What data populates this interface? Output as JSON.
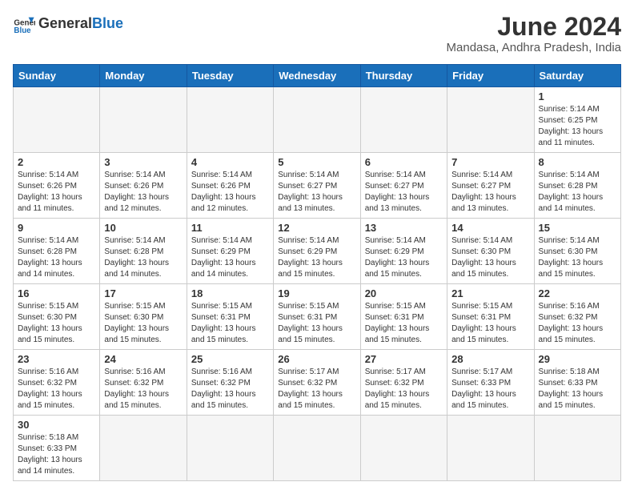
{
  "header": {
    "logo_general": "General",
    "logo_blue": "Blue",
    "month_year": "June 2024",
    "location": "Mandasa, Andhra Pradesh, India"
  },
  "weekdays": [
    "Sunday",
    "Monday",
    "Tuesday",
    "Wednesday",
    "Thursday",
    "Friday",
    "Saturday"
  ],
  "weeks": [
    [
      {
        "day": "",
        "info": ""
      },
      {
        "day": "",
        "info": ""
      },
      {
        "day": "",
        "info": ""
      },
      {
        "day": "",
        "info": ""
      },
      {
        "day": "",
        "info": ""
      },
      {
        "day": "",
        "info": ""
      },
      {
        "day": "1",
        "info": "Sunrise: 5:14 AM\nSunset: 6:25 PM\nDaylight: 13 hours and 11 minutes."
      }
    ],
    [
      {
        "day": "2",
        "info": "Sunrise: 5:14 AM\nSunset: 6:26 PM\nDaylight: 13 hours and 11 minutes."
      },
      {
        "day": "3",
        "info": "Sunrise: 5:14 AM\nSunset: 6:26 PM\nDaylight: 13 hours and 12 minutes."
      },
      {
        "day": "4",
        "info": "Sunrise: 5:14 AM\nSunset: 6:26 PM\nDaylight: 13 hours and 12 minutes."
      },
      {
        "day": "5",
        "info": "Sunrise: 5:14 AM\nSunset: 6:27 PM\nDaylight: 13 hours and 13 minutes."
      },
      {
        "day": "6",
        "info": "Sunrise: 5:14 AM\nSunset: 6:27 PM\nDaylight: 13 hours and 13 minutes."
      },
      {
        "day": "7",
        "info": "Sunrise: 5:14 AM\nSunset: 6:27 PM\nDaylight: 13 hours and 13 minutes."
      },
      {
        "day": "8",
        "info": "Sunrise: 5:14 AM\nSunset: 6:28 PM\nDaylight: 13 hours and 14 minutes."
      }
    ],
    [
      {
        "day": "9",
        "info": "Sunrise: 5:14 AM\nSunset: 6:28 PM\nDaylight: 13 hours and 14 minutes."
      },
      {
        "day": "10",
        "info": "Sunrise: 5:14 AM\nSunset: 6:28 PM\nDaylight: 13 hours and 14 minutes."
      },
      {
        "day": "11",
        "info": "Sunrise: 5:14 AM\nSunset: 6:29 PM\nDaylight: 13 hours and 14 minutes."
      },
      {
        "day": "12",
        "info": "Sunrise: 5:14 AM\nSunset: 6:29 PM\nDaylight: 13 hours and 15 minutes."
      },
      {
        "day": "13",
        "info": "Sunrise: 5:14 AM\nSunset: 6:29 PM\nDaylight: 13 hours and 15 minutes."
      },
      {
        "day": "14",
        "info": "Sunrise: 5:14 AM\nSunset: 6:30 PM\nDaylight: 13 hours and 15 minutes."
      },
      {
        "day": "15",
        "info": "Sunrise: 5:14 AM\nSunset: 6:30 PM\nDaylight: 13 hours and 15 minutes."
      }
    ],
    [
      {
        "day": "16",
        "info": "Sunrise: 5:15 AM\nSunset: 6:30 PM\nDaylight: 13 hours and 15 minutes."
      },
      {
        "day": "17",
        "info": "Sunrise: 5:15 AM\nSunset: 6:30 PM\nDaylight: 13 hours and 15 minutes."
      },
      {
        "day": "18",
        "info": "Sunrise: 5:15 AM\nSunset: 6:31 PM\nDaylight: 13 hours and 15 minutes."
      },
      {
        "day": "19",
        "info": "Sunrise: 5:15 AM\nSunset: 6:31 PM\nDaylight: 13 hours and 15 minutes."
      },
      {
        "day": "20",
        "info": "Sunrise: 5:15 AM\nSunset: 6:31 PM\nDaylight: 13 hours and 15 minutes."
      },
      {
        "day": "21",
        "info": "Sunrise: 5:15 AM\nSunset: 6:31 PM\nDaylight: 13 hours and 15 minutes."
      },
      {
        "day": "22",
        "info": "Sunrise: 5:16 AM\nSunset: 6:32 PM\nDaylight: 13 hours and 15 minutes."
      }
    ],
    [
      {
        "day": "23",
        "info": "Sunrise: 5:16 AM\nSunset: 6:32 PM\nDaylight: 13 hours and 15 minutes."
      },
      {
        "day": "24",
        "info": "Sunrise: 5:16 AM\nSunset: 6:32 PM\nDaylight: 13 hours and 15 minutes."
      },
      {
        "day": "25",
        "info": "Sunrise: 5:16 AM\nSunset: 6:32 PM\nDaylight: 13 hours and 15 minutes."
      },
      {
        "day": "26",
        "info": "Sunrise: 5:17 AM\nSunset: 6:32 PM\nDaylight: 13 hours and 15 minutes."
      },
      {
        "day": "27",
        "info": "Sunrise: 5:17 AM\nSunset: 6:32 PM\nDaylight: 13 hours and 15 minutes."
      },
      {
        "day": "28",
        "info": "Sunrise: 5:17 AM\nSunset: 6:33 PM\nDaylight: 13 hours and 15 minutes."
      },
      {
        "day": "29",
        "info": "Sunrise: 5:18 AM\nSunset: 6:33 PM\nDaylight: 13 hours and 15 minutes."
      }
    ],
    [
      {
        "day": "30",
        "info": "Sunrise: 5:18 AM\nSunset: 6:33 PM\nDaylight: 13 hours and 14 minutes."
      },
      {
        "day": "",
        "info": ""
      },
      {
        "day": "",
        "info": ""
      },
      {
        "day": "",
        "info": ""
      },
      {
        "day": "",
        "info": ""
      },
      {
        "day": "",
        "info": ""
      },
      {
        "day": "",
        "info": ""
      }
    ]
  ]
}
